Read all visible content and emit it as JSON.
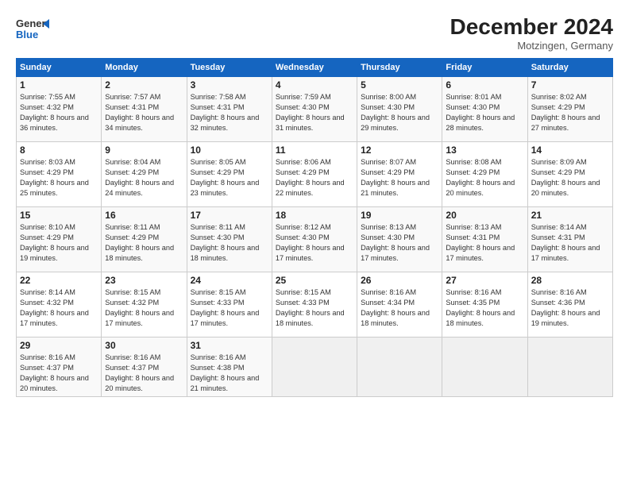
{
  "header": {
    "logo_line1": "General",
    "logo_line2": "Blue",
    "month": "December 2024",
    "location": "Motzingen, Germany"
  },
  "weekdays": [
    "Sunday",
    "Monday",
    "Tuesday",
    "Wednesday",
    "Thursday",
    "Friday",
    "Saturday"
  ],
  "weeks": [
    [
      {
        "day": "1",
        "sunrise": "7:55 AM",
        "sunset": "4:32 PM",
        "daylight": "8 hours and 36 minutes."
      },
      {
        "day": "2",
        "sunrise": "7:57 AM",
        "sunset": "4:31 PM",
        "daylight": "8 hours and 34 minutes."
      },
      {
        "day": "3",
        "sunrise": "7:58 AM",
        "sunset": "4:31 PM",
        "daylight": "8 hours and 32 minutes."
      },
      {
        "day": "4",
        "sunrise": "7:59 AM",
        "sunset": "4:30 PM",
        "daylight": "8 hours and 31 minutes."
      },
      {
        "day": "5",
        "sunrise": "8:00 AM",
        "sunset": "4:30 PM",
        "daylight": "8 hours and 29 minutes."
      },
      {
        "day": "6",
        "sunrise": "8:01 AM",
        "sunset": "4:30 PM",
        "daylight": "8 hours and 28 minutes."
      },
      {
        "day": "7",
        "sunrise": "8:02 AM",
        "sunset": "4:29 PM",
        "daylight": "8 hours and 27 minutes."
      }
    ],
    [
      {
        "day": "8",
        "sunrise": "8:03 AM",
        "sunset": "4:29 PM",
        "daylight": "8 hours and 25 minutes."
      },
      {
        "day": "9",
        "sunrise": "8:04 AM",
        "sunset": "4:29 PM",
        "daylight": "8 hours and 24 minutes."
      },
      {
        "day": "10",
        "sunrise": "8:05 AM",
        "sunset": "4:29 PM",
        "daylight": "8 hours and 23 minutes."
      },
      {
        "day": "11",
        "sunrise": "8:06 AM",
        "sunset": "4:29 PM",
        "daylight": "8 hours and 22 minutes."
      },
      {
        "day": "12",
        "sunrise": "8:07 AM",
        "sunset": "4:29 PM",
        "daylight": "8 hours and 21 minutes."
      },
      {
        "day": "13",
        "sunrise": "8:08 AM",
        "sunset": "4:29 PM",
        "daylight": "8 hours and 20 minutes."
      },
      {
        "day": "14",
        "sunrise": "8:09 AM",
        "sunset": "4:29 PM",
        "daylight": "8 hours and 20 minutes."
      }
    ],
    [
      {
        "day": "15",
        "sunrise": "8:10 AM",
        "sunset": "4:29 PM",
        "daylight": "8 hours and 19 minutes."
      },
      {
        "day": "16",
        "sunrise": "8:11 AM",
        "sunset": "4:29 PM",
        "daylight": "8 hours and 18 minutes."
      },
      {
        "day": "17",
        "sunrise": "8:11 AM",
        "sunset": "4:30 PM",
        "daylight": "8 hours and 18 minutes."
      },
      {
        "day": "18",
        "sunrise": "8:12 AM",
        "sunset": "4:30 PM",
        "daylight": "8 hours and 17 minutes."
      },
      {
        "day": "19",
        "sunrise": "8:13 AM",
        "sunset": "4:30 PM",
        "daylight": "8 hours and 17 minutes."
      },
      {
        "day": "20",
        "sunrise": "8:13 AM",
        "sunset": "4:31 PM",
        "daylight": "8 hours and 17 minutes."
      },
      {
        "day": "21",
        "sunrise": "8:14 AM",
        "sunset": "4:31 PM",
        "daylight": "8 hours and 17 minutes."
      }
    ],
    [
      {
        "day": "22",
        "sunrise": "8:14 AM",
        "sunset": "4:32 PM",
        "daylight": "8 hours and 17 minutes."
      },
      {
        "day": "23",
        "sunrise": "8:15 AM",
        "sunset": "4:32 PM",
        "daylight": "8 hours and 17 minutes."
      },
      {
        "day": "24",
        "sunrise": "8:15 AM",
        "sunset": "4:33 PM",
        "daylight": "8 hours and 17 minutes."
      },
      {
        "day": "25",
        "sunrise": "8:15 AM",
        "sunset": "4:33 PM",
        "daylight": "8 hours and 18 minutes."
      },
      {
        "day": "26",
        "sunrise": "8:16 AM",
        "sunset": "4:34 PM",
        "daylight": "8 hours and 18 minutes."
      },
      {
        "day": "27",
        "sunrise": "8:16 AM",
        "sunset": "4:35 PM",
        "daylight": "8 hours and 18 minutes."
      },
      {
        "day": "28",
        "sunrise": "8:16 AM",
        "sunset": "4:36 PM",
        "daylight": "8 hours and 19 minutes."
      }
    ],
    [
      {
        "day": "29",
        "sunrise": "8:16 AM",
        "sunset": "4:37 PM",
        "daylight": "8 hours and 20 minutes."
      },
      {
        "day": "30",
        "sunrise": "8:16 AM",
        "sunset": "4:37 PM",
        "daylight": "8 hours and 20 minutes."
      },
      {
        "day": "31",
        "sunrise": "8:16 AM",
        "sunset": "4:38 PM",
        "daylight": "8 hours and 21 minutes."
      },
      null,
      null,
      null,
      null
    ]
  ]
}
